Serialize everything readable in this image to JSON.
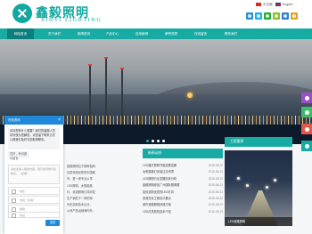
{
  "header": {
    "logo_cn": "鑫毅照明",
    "logo_en": "XINYI LIGHTING",
    "lang_cn": "中文版",
    "lang_en": "English"
  },
  "nav": {
    "items": [
      "网站首页",
      "关于我们",
      "新闻资讯",
      "产品中心",
      "应用案例",
      "荣誉资质",
      "在线留言",
      "联系我们"
    ],
    "active_index": 0
  },
  "hero": {
    "slide_count": 4,
    "active_slide": 1
  },
  "about": {
    "text": [
      "鑫毅照明位于拥有独特",
      "优质资源优势的中国城",
      "市，是一家专业从事",
      "LED照明、太阳能路",
      "灯、景观照明灯具研发",
      "生产销售于一体的现",
      "代化高新技术企业。",
      "公司产品远销海内外。"
    ]
  },
  "news": {
    "title": "新闻动态",
    "items": [
      {
        "title": "LED路灯照明节能效果显著",
        "date": "2015-08-22"
      },
      {
        "title": "太阳能路灯安装注意事项",
        "date": "2015-08-22"
      },
      {
        "title": "LED照明行业发展前景分析",
        "date": "2015-08-22"
      },
      {
        "title": "鑫毅照明参加广州国际照明展",
        "date": "2015-08-21"
      },
      {
        "title": "如何选购优质的LED灯具",
        "date": "2015-08-21"
      },
      {
        "title": "景观亮化工程设计要点",
        "date": "2015-08-20"
      },
      {
        "title": "城市道路照明改造方案",
        "date": "2015-08-20"
      },
      {
        "title": "LED灯具散热技术介绍",
        "date": "2015-08-19"
      }
    ]
  },
  "cases": {
    "title": "工程案例",
    "caption": "LED道路照明"
  },
  "chat": {
    "title": "在线咨询",
    "close": "×",
    "greeting": "请问您有什么需要？我们的客服人员将尽快为您解答，请您留下联系方式以便我们及时与您取得联系。",
    "reply": "您好，有问题请留言",
    "placeholder": "请在此输入留言内容，我们会尽快与您联系。（必填）",
    "name_placeholder": "姓名",
    "phone_placeholder": "电话（必填）",
    "email_placeholder": "邮箱",
    "address_placeholder": "地址",
    "send": "发送"
  },
  "colors": {
    "brand": "#18aba4",
    "nav_active": "#0b7f7b",
    "chat_blue": "#1f88d8",
    "side_purple": "#9b4fc7",
    "side_green": "#3dbd6a",
    "side_red": "#e2584a",
    "side_teal": "#18aba4"
  },
  "side_icons": [
    "chat-icon",
    "qq-icon",
    "phone-icon",
    "top-icon"
  ]
}
